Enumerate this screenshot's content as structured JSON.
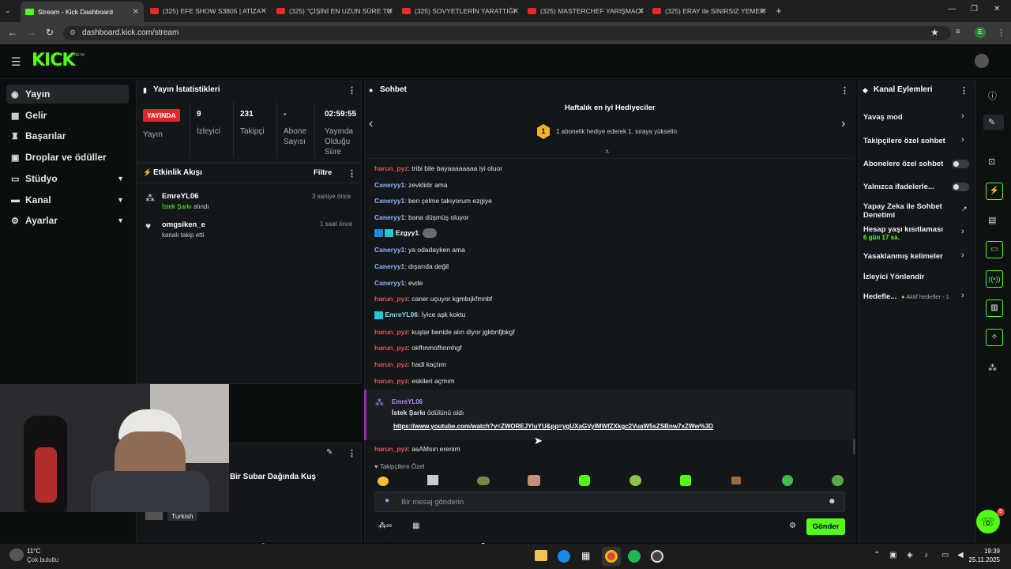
{
  "browser": {
    "tabs": [
      {
        "title": "Stream - Kick Dashboard",
        "active": true
      },
      {
        "title": "(325) EFE SHOW S3805 | ATİZA",
        "active": false
      },
      {
        "title": "(325) \"ÇİŞİNİ EN UZUN SÜRE TU",
        "active": false
      },
      {
        "title": "(325) SOVYETLERİN YARATTIĞI",
        "active": false
      },
      {
        "title": "(325) MASTERCHEF YARIŞMACI",
        "active": false
      },
      {
        "title": "(325) ERAY ile SINIRSIZ YEMEK",
        "active": false
      }
    ],
    "url": "dashboard.kick.com/stream",
    "profile_letter": "E"
  },
  "brand": {
    "logo": "KICK",
    "beta": "BETA",
    "accent": "#53fc18"
  },
  "sidebar": {
    "items": [
      {
        "label": "Yayın",
        "icon": "broadcast-icon"
      },
      {
        "label": "Gelir",
        "icon": "income-icon"
      },
      {
        "label": "Başarılar",
        "icon": "trophy-icon"
      },
      {
        "label": "Droplar ve ödüller",
        "icon": "gift-icon"
      },
      {
        "label": "Stüdyo",
        "icon": "studio-icon"
      },
      {
        "label": "Kanal",
        "icon": "channel-icon"
      },
      {
        "label": "Ayarlar",
        "icon": "gear-icon"
      }
    ]
  },
  "stats": {
    "title": "Yayın İstatistikleri",
    "live_badge": "YAYINDA",
    "items": [
      {
        "value": "",
        "label": "Yayın"
      },
      {
        "value": "9",
        "label": "İzleyici"
      },
      {
        "value": "231",
        "label": "Takipçi"
      },
      {
        "value": "-",
        "label": "Abone Sayısı"
      },
      {
        "value": "02:59:55",
        "label": "Yayında Olduğu Süre"
      }
    ]
  },
  "activity": {
    "title": "Etkinlik Akışı",
    "filter": "Filtre",
    "items": [
      {
        "user": "EmreYL06",
        "detail_green": "İstek Şarkı",
        "detail": " alındı",
        "time": "3 saniye önce"
      },
      {
        "user": "omgsiken_e",
        "detail_green": "",
        "detail": "kanalı takip etti",
        "time": "1 saat önce"
      }
    ]
  },
  "stream_info": {
    "title": "Bir Subar Dağında Kuş",
    "language": "Turkish"
  },
  "chat": {
    "title": "Sohbet",
    "gifters_title": "Haftalık en iyi Hediyeciler",
    "gifters_text": "1 abonelik hediye ederek 1. sıraya yükselin",
    "gifters_rank": "1",
    "messages": [
      {
        "user": "harun_pyz",
        "text": ": tribi bile bayaaaaaaaa iyi oluor",
        "color": "red"
      },
      {
        "user": "Caneryy1",
        "text": ": zevklidir ama",
        "color": "blue"
      },
      {
        "user": "Caneryy1",
        "text": ": ben çelme takıyorum ezgiye",
        "color": "blue"
      },
      {
        "user": "Caneryy1",
        "text": ": bana düşmüş oluyor",
        "color": "blue"
      },
      {
        "user": "Ezgyy1",
        "text": ":",
        "color": "white"
      },
      {
        "user": "Caneryy1",
        "text": ": ya odadayken ama",
        "color": "blue"
      },
      {
        "user": "Caneryy1",
        "text": ": dışarıda değil",
        "color": "blue"
      },
      {
        "user": "Caneryy1",
        "text": ": evde",
        "color": "blue"
      },
      {
        "user": "harun_pyz",
        "text": ": caner uçuyor kgmbıjkfmnbf",
        "color": "red"
      },
      {
        "user": "EmreYL06",
        "text": ": İyice aşk koktu",
        "color": "cyan"
      },
      {
        "user": "harun_pyz",
        "text": ": kuşlar benide alın diyor jgkbnfjbkgf",
        "color": "red"
      },
      {
        "user": "harun_pyz",
        "text": ": okfhnmofhnmhgf",
        "color": "red"
      },
      {
        "user": "harun_pyz",
        "text": ": hadi kaçtım",
        "color": "red"
      },
      {
        "user": "harun_pyz",
        "text": ": eskileri açmım",
        "color": "red"
      }
    ],
    "reward": {
      "user": "EmreYL06",
      "reward_name": "İstek Şarkı",
      "reward_text": " ödülünü aldı",
      "link": "https://www.youtube.com/watch?v=ZWOREJYluYU&pp=ygUXaGVylMWfZXkgc2VuaW5sZSBnw7xZWw%3D"
    },
    "last_message": {
      "user": "harun_pyz",
      "text": ": asAMsın erenim"
    },
    "followers_only": "Takipçilere Özel",
    "input_placeholder": "Bir mesaj gönderin",
    "send_label": "Gönder"
  },
  "channel_actions": {
    "title": "Kanal Eylemleri",
    "items": [
      {
        "label": "Yavaş mod",
        "control": "chevron"
      },
      {
        "label": "Takipçilere özel sohbet",
        "control": "chevron"
      },
      {
        "label": "Abonelere özel sohbet",
        "control": "toggle"
      },
      {
        "label": "Yalnızca ifadelerle...",
        "control": "toggle"
      },
      {
        "label": "Yapay Zeka ile Sohbet Denetimi",
        "control": "external"
      },
      {
        "label": "Hesap yaşı kısıtlaması",
        "sub": "6 gün 17 sa.",
        "control": "chevron"
      },
      {
        "label": "Yasaklanmış kelimeler",
        "control": "chevron"
      },
      {
        "label": "İzleyici Yönlendir",
        "control": "none"
      },
      {
        "label": "Hedefle...",
        "sub_inline": "Aktif hedefler - 1",
        "control": "chevron"
      }
    ]
  },
  "overlay_caption": {
    "user": "harun_pyz",
    "text": ": asAMsın erenim"
  },
  "taskbar": {
    "weather_temp": "11°C",
    "weather_text": "Çok bulutlu",
    "time": "19:39",
    "date": "25.11.2025",
    "support_badge": "5"
  }
}
